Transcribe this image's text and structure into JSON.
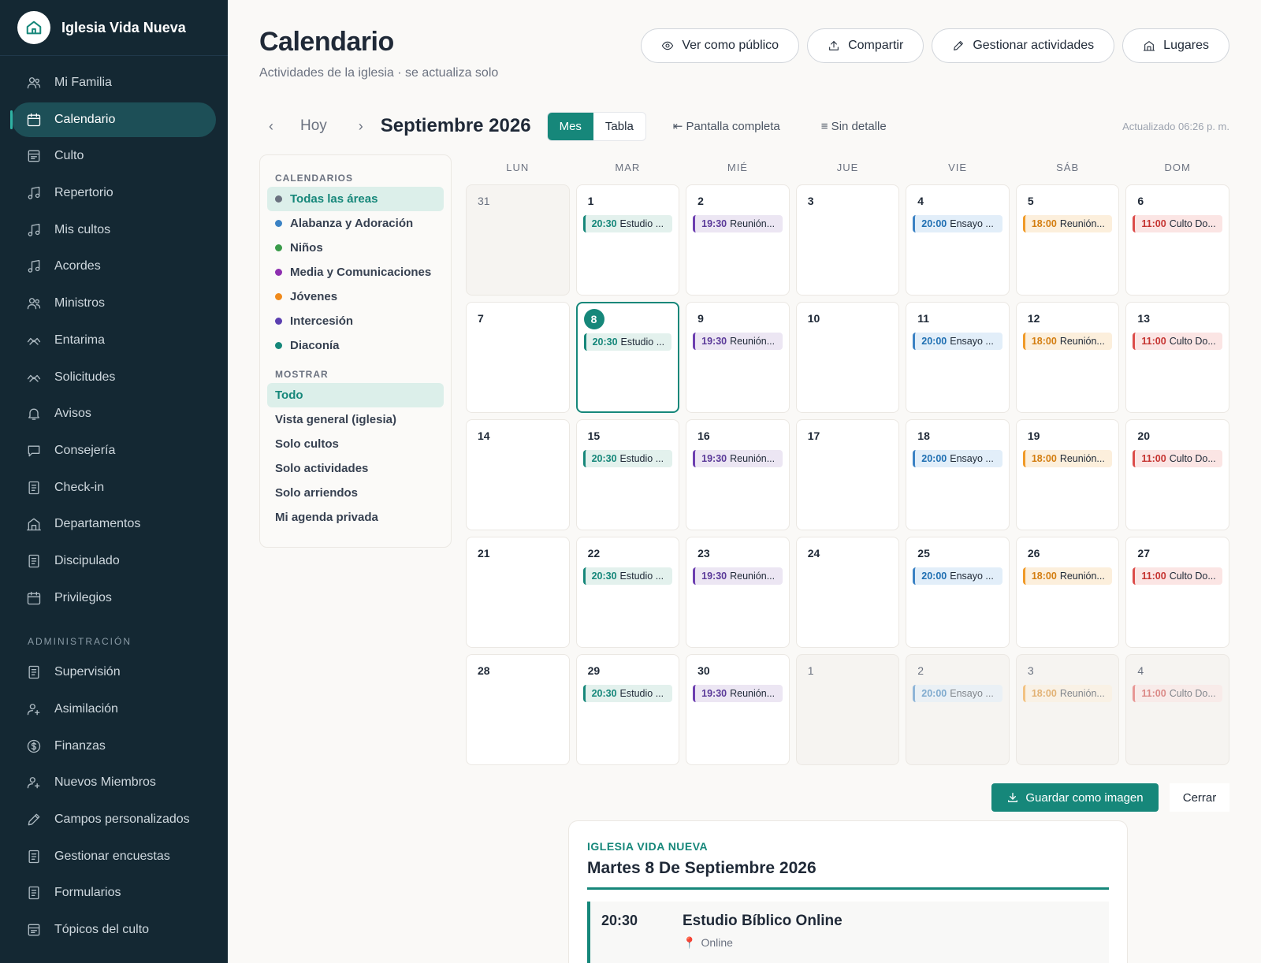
{
  "sidebar": {
    "brand": "Iglesia Vida Nueva",
    "items": [
      {
        "label": "Mi Familia",
        "icon": "users-icon",
        "name": "sidebar-item-mi-familia"
      },
      {
        "label": "Calendario",
        "icon": "calendar-icon",
        "name": "sidebar-item-calendario",
        "active": true
      },
      {
        "label": "Culto",
        "icon": "book-icon",
        "name": "sidebar-item-culto"
      },
      {
        "label": "Repertorio",
        "icon": "music-icon",
        "name": "sidebar-item-repertorio"
      },
      {
        "label": "Mis cultos",
        "icon": "music-icon",
        "name": "sidebar-item-mis-cultos"
      },
      {
        "label": "Acordes",
        "icon": "music-icon",
        "name": "sidebar-item-acordes"
      },
      {
        "label": "Ministros",
        "icon": "users-icon",
        "name": "sidebar-item-ministros"
      },
      {
        "label": "Entarima",
        "icon": "signal-icon",
        "name": "sidebar-item-entarima"
      },
      {
        "label": "Solicitudes",
        "icon": "signal-icon",
        "name": "sidebar-item-solicitudes"
      },
      {
        "label": "Avisos",
        "icon": "bell-icon",
        "name": "sidebar-item-avisos"
      },
      {
        "label": "Consejería",
        "icon": "chat-icon",
        "name": "sidebar-item-consejeria"
      },
      {
        "label": "Check-in",
        "icon": "clipboard-icon",
        "name": "sidebar-item-check-in"
      },
      {
        "label": "Departamentos",
        "icon": "building-icon",
        "name": "sidebar-item-departamentos"
      },
      {
        "label": "Discipulado",
        "icon": "clipboard-icon",
        "name": "sidebar-item-discipulado"
      },
      {
        "label": "Privilegios",
        "icon": "calendar-icon",
        "name": "sidebar-item-privilegios"
      }
    ],
    "admin_section": "ADMINISTRACIÓN",
    "admin_items": [
      {
        "label": "Supervisión",
        "icon": "clipboard-icon",
        "name": "sidebar-item-supervision"
      },
      {
        "label": "Asimilación",
        "icon": "user-add-icon",
        "name": "sidebar-item-asimilacion"
      },
      {
        "label": "Finanzas",
        "icon": "dollar-icon",
        "name": "sidebar-item-finanzas"
      },
      {
        "label": "Nuevos Miembros",
        "icon": "user-add-icon",
        "name": "sidebar-item-nuevos-miembros"
      },
      {
        "label": "Campos personalizados",
        "icon": "pencil-icon",
        "name": "sidebar-item-campos-personalizados"
      },
      {
        "label": "Gestionar encuestas",
        "icon": "clipboard-icon",
        "name": "sidebar-item-gestionar-encuestas"
      },
      {
        "label": "Formularios",
        "icon": "clipboard-icon",
        "name": "sidebar-item-formularios"
      },
      {
        "label": "Tópicos del culto",
        "icon": "book-icon",
        "name": "sidebar-item-topicos-del-culto"
      }
    ]
  },
  "header": {
    "title": "Calendario",
    "subtitle": "Actividades de la iglesia · se actualiza solo",
    "actions": [
      {
        "label": "Ver como público",
        "icon": "eye-icon",
        "name": "ver-como-publico-button"
      },
      {
        "label": "Compartir",
        "icon": "share-icon",
        "name": "compartir-button"
      },
      {
        "label": "Gestionar actividades",
        "icon": "pencil-icon",
        "name": "gestionar-actividades-button"
      },
      {
        "label": "Lugares",
        "icon": "building-icon",
        "name": "lugares-button"
      }
    ]
  },
  "toolbar": {
    "prev": "‹",
    "today": "Hoy",
    "next": "›",
    "month": "Septiembre 2026",
    "view_month": "Mes",
    "view_table": "Tabla",
    "fullscreen": "⇤ Pantalla completa",
    "no_detail": "≡ Sin detalle",
    "updated": "Actualizado 06:26 p. m."
  },
  "filters": {
    "calendars_heading": "CALENDARIOS",
    "calendars": [
      {
        "label": "Todas las áreas",
        "color": "#6b7280",
        "active": true
      },
      {
        "label": "Alabanza y Adoración",
        "color": "#3b82c4"
      },
      {
        "label": "Niños",
        "color": "#3a9b4a"
      },
      {
        "label": "Media y Comunicaciones",
        "color": "#8e2fb0"
      },
      {
        "label": "Jóvenes",
        "color": "#f08a1c"
      },
      {
        "label": "Intercesión",
        "color": "#5b3fb0"
      },
      {
        "label": "Diaconía",
        "color": "#16877a"
      }
    ],
    "show_heading": "MOSTRAR",
    "show": [
      {
        "label": "Todo",
        "active": true
      },
      {
        "label": "Vista general (iglesia)"
      },
      {
        "label": "Solo cultos"
      },
      {
        "label": "Solo actividades"
      },
      {
        "label": "Solo arriendos"
      },
      {
        "label": "Mi agenda privada"
      }
    ]
  },
  "calendar": {
    "weekdays": [
      "LUN",
      "MAR",
      "MIÉ",
      "JUE",
      "VIE",
      "SÁB",
      "DOM"
    ],
    "events": {
      "mar": {
        "time": "20:30",
        "title": "Estudio ...",
        "cls": "c1"
      },
      "mie": {
        "time": "19:30",
        "title": "Reunión...",
        "cls": "c2"
      },
      "vie": {
        "time": "20:00",
        "title": "Ensayo ...",
        "cls": "c3"
      },
      "sab": {
        "time": "18:00",
        "title": "Reunión...",
        "cls": "c4"
      },
      "dom": {
        "time": "11:00",
        "title": "Culto Do...",
        "cls": "c5"
      }
    },
    "weeks": [
      [
        {
          "n": "31",
          "m": true
        },
        {
          "n": "1",
          "e": "mar"
        },
        {
          "n": "2",
          "e": "mie"
        },
        {
          "n": "3"
        },
        {
          "n": "4",
          "e": "vie"
        },
        {
          "n": "5",
          "e": "sab"
        },
        {
          "n": "6",
          "e": "dom"
        }
      ],
      [
        {
          "n": "7"
        },
        {
          "n": "8",
          "e": "mar",
          "t": true
        },
        {
          "n": "9",
          "e": "mie"
        },
        {
          "n": "10"
        },
        {
          "n": "11",
          "e": "vie"
        },
        {
          "n": "12",
          "e": "sab"
        },
        {
          "n": "13",
          "e": "dom"
        }
      ],
      [
        {
          "n": "14"
        },
        {
          "n": "15",
          "e": "mar"
        },
        {
          "n": "16",
          "e": "mie"
        },
        {
          "n": "17"
        },
        {
          "n": "18",
          "e": "vie"
        },
        {
          "n": "19",
          "e": "sab"
        },
        {
          "n": "20",
          "e": "dom"
        }
      ],
      [
        {
          "n": "21"
        },
        {
          "n": "22",
          "e": "mar"
        },
        {
          "n": "23",
          "e": "mie"
        },
        {
          "n": "24"
        },
        {
          "n": "25",
          "e": "vie"
        },
        {
          "n": "26",
          "e": "sab"
        },
        {
          "n": "27",
          "e": "dom"
        }
      ],
      [
        {
          "n": "28"
        },
        {
          "n": "29",
          "e": "mar"
        },
        {
          "n": "30",
          "e": "mie"
        },
        {
          "n": "1",
          "m": true
        },
        {
          "n": "2",
          "e": "vie",
          "m": true
        },
        {
          "n": "3",
          "e": "sab",
          "m": true
        },
        {
          "n": "4",
          "e": "dom",
          "m": true
        }
      ]
    ]
  },
  "footer_actions": {
    "save_image": "Guardar como imagen",
    "close": "Cerrar"
  },
  "detail": {
    "org": "IGLESIA VIDA NUEVA",
    "date": "Martes 8 De Septiembre 2026",
    "event_time": "20:30",
    "event_title": "Estudio Bíblico Online",
    "event_location": "Online"
  }
}
